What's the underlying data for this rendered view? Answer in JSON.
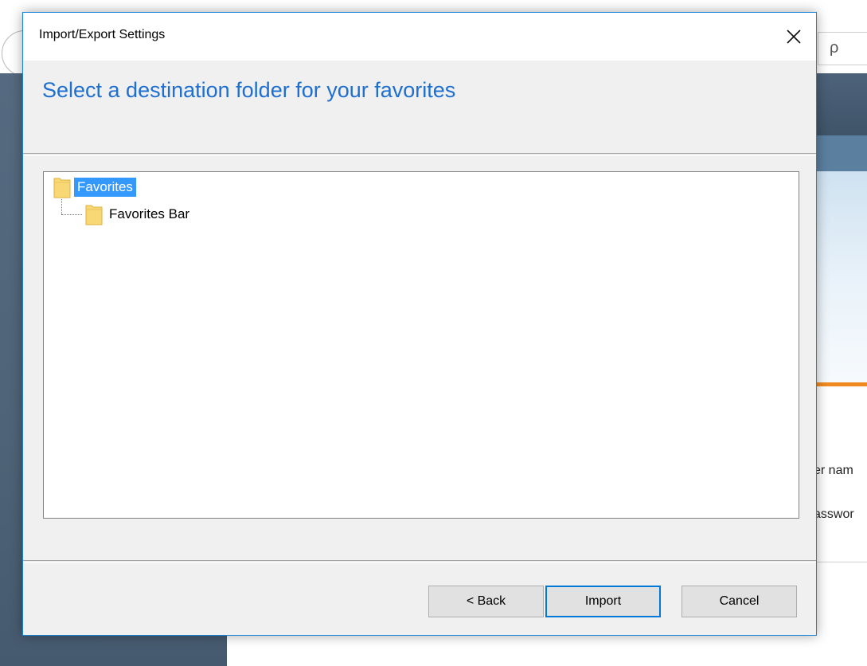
{
  "dialog": {
    "title": "Import/Export Settings",
    "close_glyph": "✕",
    "heading": "Select a destination folder for your favorites",
    "tree": [
      {
        "label": "Favorites",
        "selected": true,
        "level": 0
      },
      {
        "label": "Favorites Bar",
        "selected": false,
        "level": 1
      }
    ],
    "buttons": {
      "back": "< Back",
      "import": "Import",
      "cancel": "Cancel"
    }
  },
  "background": {
    "search_glyph": "ρ",
    "label_1": "er nam",
    "label_2": "asswor"
  },
  "colors": {
    "accent": "#1e6fd0",
    "selection": "#3399ff",
    "dialog_border": "#1883d7",
    "folder": "#f8d775"
  }
}
